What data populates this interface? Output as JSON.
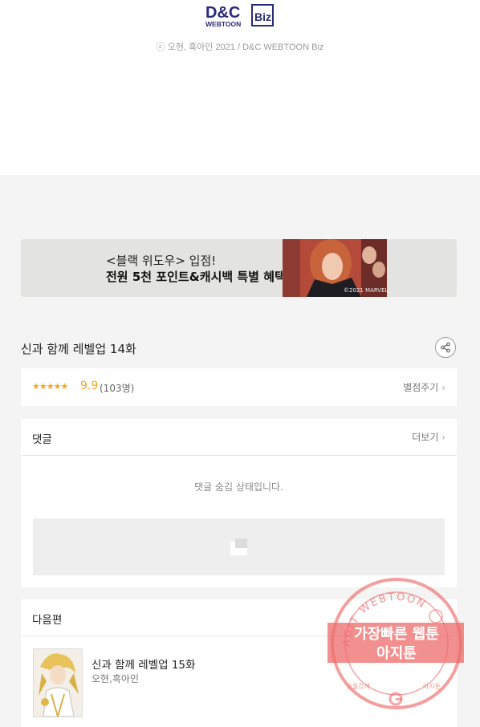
{
  "header": {
    "logo_text_top": "D&C",
    "logo_text_bottom": "WEBTOON",
    "logo_badge": "Biz",
    "copyright": "ⓒ 오현, 흑아인 2021 / D&C WEBTOON Biz"
  },
  "banner": {
    "line1": "<블랙 위도우> 입점!",
    "line2": "전원 5천 포인트&캐시백 특별 혜택",
    "credit": "©2021 MARVEL"
  },
  "episode": {
    "title": "신과 함께 레벨업 14화"
  },
  "rating": {
    "stars": "★★★★★",
    "score": "9.9",
    "count": "(103명)",
    "rate_label": "별점주기"
  },
  "comments": {
    "heading": "댓글",
    "more_label": "더보기",
    "hidden_message": "댓글 숨김 상태입니다."
  },
  "next_episode": {
    "heading": "다음편",
    "title": "신과 함께 레벨업 15화",
    "author": "오현,흑아인"
  },
  "watermark": {
    "ring_text": "AGIT WEBTOON",
    "line1": "가장빠른 웹툰",
    "line2": "아지툰",
    "bottom_left": "고퀄검색",
    "bottom_right": "아지툰"
  },
  "colors": {
    "star": "#f5a623",
    "stamp": "#e94a4a",
    "background": "#f4f4f4"
  }
}
